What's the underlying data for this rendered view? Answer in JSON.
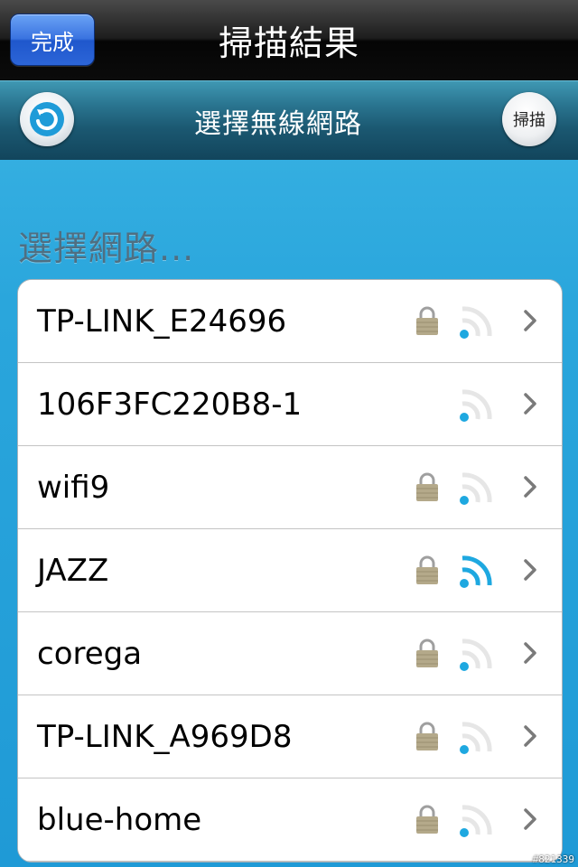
{
  "navbar": {
    "done_label": "完成",
    "title": "掃描結果"
  },
  "toolbar": {
    "title": "選擇無線網路",
    "scan_label": "掃描",
    "refresh_icon": "refresh-icon"
  },
  "section": {
    "heading": "選擇網路..."
  },
  "networks": [
    {
      "name": "TP-LINK_E24696",
      "locked": true,
      "signal": "low"
    },
    {
      "name": "106F3FC220B8-1",
      "locked": false,
      "signal": "low"
    },
    {
      "name": "wifi9",
      "locked": true,
      "signal": "low"
    },
    {
      "name": "JAZZ",
      "locked": true,
      "signal": "full"
    },
    {
      "name": "corega",
      "locked": true,
      "signal": "low"
    },
    {
      "name": "TP-LINK_A969D8",
      "locked": true,
      "signal": "low"
    },
    {
      "name": "blue-home",
      "locked": true,
      "signal": "low"
    }
  ],
  "colors": {
    "wifi_active": "#1ea8e0",
    "wifi_inactive": "#e6e6e6",
    "lock": "#b4a98a"
  },
  "watermark": "#821339"
}
